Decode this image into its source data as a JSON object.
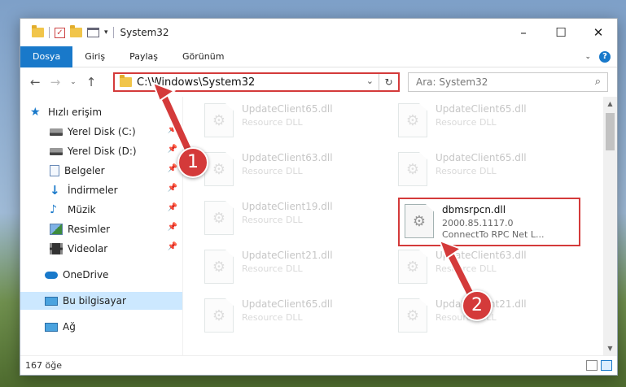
{
  "window": {
    "title": "System32"
  },
  "ribbon": {
    "tabs": [
      "Dosya",
      "Giriş",
      "Paylaş",
      "Görünüm"
    ]
  },
  "address": {
    "path": "C:\\Windows\\System32",
    "refresh_icon": "refresh-icon"
  },
  "search": {
    "placeholder": "Ara: System32"
  },
  "sidebar": {
    "items": [
      {
        "label": "Hızlı erişim",
        "icon": "star-icon"
      },
      {
        "label": "Yerel Disk (C:)",
        "icon": "drive-icon"
      },
      {
        "label": "Yerel Disk (D:)",
        "icon": "drive-icon"
      },
      {
        "label": "Belgeler",
        "icon": "documents-icon"
      },
      {
        "label": "İndirmeler",
        "icon": "downloads-icon"
      },
      {
        "label": "Müzik",
        "icon": "music-icon"
      },
      {
        "label": "Resimler",
        "icon": "pictures-icon"
      },
      {
        "label": "Videolar",
        "icon": "videos-icon"
      },
      {
        "label": "OneDrive",
        "icon": "onedrive-icon"
      },
      {
        "label": "Bu bilgisayar",
        "icon": "computer-icon"
      },
      {
        "label": "Ağ",
        "icon": "network-icon"
      }
    ]
  },
  "files": [
    {
      "name": "UpdateClient65.dll",
      "desc": "Resource DLL"
    },
    {
      "name": "UpdateClient65.dll",
      "desc": "Resource DLL"
    },
    {
      "name": "UpdateClient63.dll",
      "desc": "Resource DLL"
    },
    {
      "name": "UpdateClient65.dll",
      "desc": "Resource DLL"
    },
    {
      "name": "UpdateClient19.dll",
      "desc": "Resource DLL"
    },
    {
      "name": "dbmsrpcn.dll",
      "version": "2000.85.1117.0",
      "desc": "ConnectTo RPC Net L..."
    },
    {
      "name": "UpdateClient21.dll",
      "desc": "Resource DLL"
    },
    {
      "name": "UpdateClient63.dll",
      "desc": "Resource DLL"
    },
    {
      "name": "UpdateClient65.dll",
      "desc": "Resource DLL"
    },
    {
      "name": "UpdateClient21.dll",
      "desc": "Resource DLL"
    }
  ],
  "status": {
    "count": "167 öğe"
  },
  "callouts": [
    "1",
    "2"
  ],
  "colors": {
    "accent": "#1979ca",
    "highlight": "#d43a3a"
  }
}
